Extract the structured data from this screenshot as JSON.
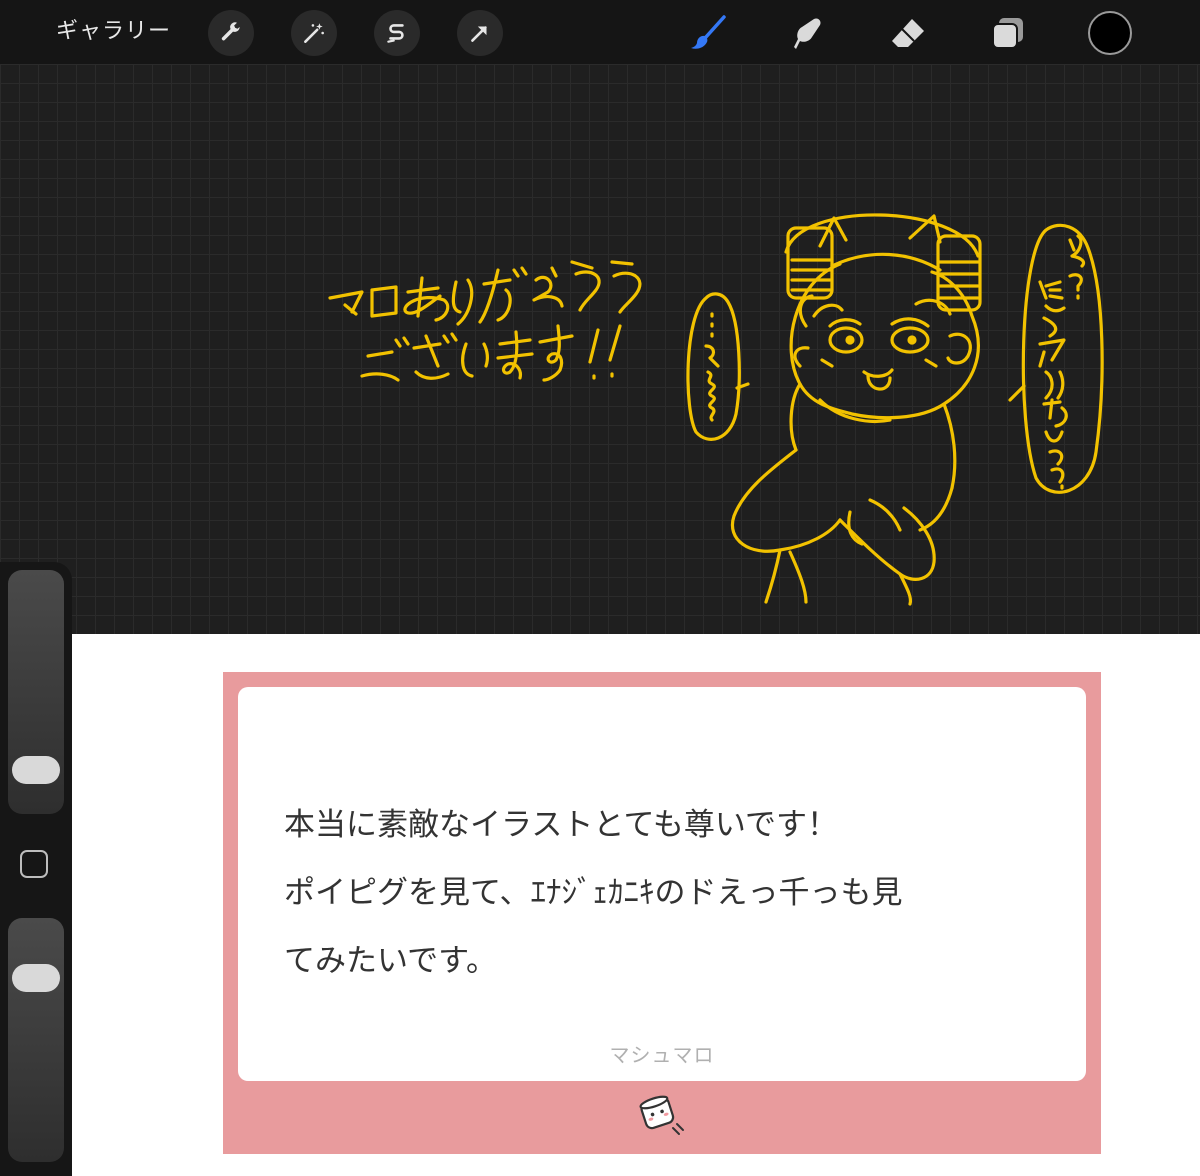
{
  "toolbar": {
    "gallery_label": "ギャラリー",
    "left_tools": [
      "wrench-icon",
      "magic-wand-icon",
      "selection-s-icon",
      "transform-arrow-icon"
    ],
    "right_tools": [
      "brush-icon",
      "smudge-icon",
      "eraser-icon",
      "layers-icon"
    ],
    "active_tool": "brush",
    "active_color": "#000000",
    "accent": "#3478f6"
  },
  "canvas": {
    "stroke_color": "#f2c200",
    "text_line1": "マロありがとう",
    "text_line2": "ございます!!",
    "bubble_left": "……え〜〜",
    "bubble_right": "え？俺とヤりたいって？？"
  },
  "sidebar": {
    "brush_size_level": 0.78,
    "opacity_level": 0.25
  },
  "card": {
    "line1": "本当に素敵なイラストとても尊いです！",
    "line2": "ポイピグを見て、ｴﾅｼﾞｪｶﾆｷのドえっ千っも見",
    "line3": "てみたいです。",
    "brand": "マシュマロ",
    "bg_color": "#e89b9d"
  }
}
